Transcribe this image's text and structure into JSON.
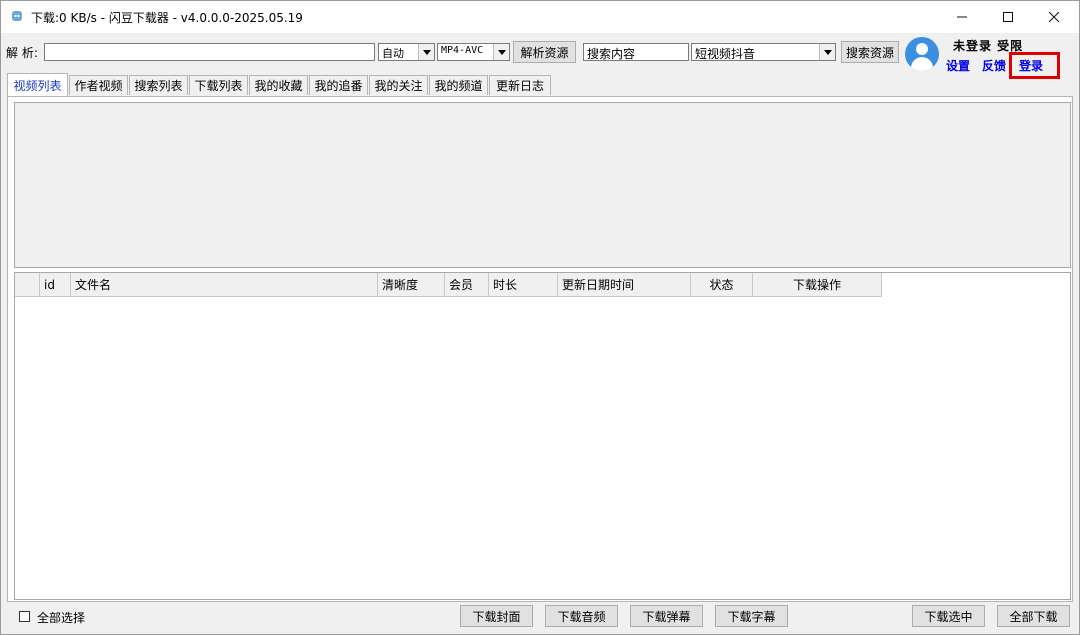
{
  "window": {
    "title": "下载:0 KB/s - 闪豆下载器 - v4.0.0.0-2025.05.19"
  },
  "toolbar": {
    "parse_label": "解 析:",
    "url_value": "",
    "mode_value": "自动",
    "format_value": "MP4-AVC",
    "parse_button": "解析资源",
    "search_value": "搜索内容",
    "platform_value": "短视频抖音",
    "search_button": "搜索资源"
  },
  "user": {
    "status": "未登录 受限",
    "settings_link": "设置",
    "feedback_link": "反馈",
    "login_link": "登录",
    "avatar_icon": "user-avatar-icon",
    "highlight_color": "#e00000"
  },
  "tabs": [
    {
      "label": "视频列表",
      "active": true
    },
    {
      "label": "作者视频"
    },
    {
      "label": "搜索列表"
    },
    {
      "label": "下载列表"
    },
    {
      "label": "我的收藏"
    },
    {
      "label": "我的追番"
    },
    {
      "label": "我的关注"
    },
    {
      "label": "我的频道"
    },
    {
      "label": "更新日志"
    }
  ],
  "table": {
    "columns": [
      "",
      "id",
      "文件名",
      "清晰度",
      "会员",
      "时长",
      "更新日期时间",
      "状态",
      "下载操作"
    ],
    "rows": []
  },
  "footer": {
    "select_all_label": "全部选择",
    "select_all_checked": false,
    "download_cover": "下载封面",
    "download_audio": "下载音频",
    "download_danmaku": "下载弹幕",
    "download_subtitle": "下载字幕",
    "download_selected": "下载选中",
    "download_all": "全部下载"
  }
}
